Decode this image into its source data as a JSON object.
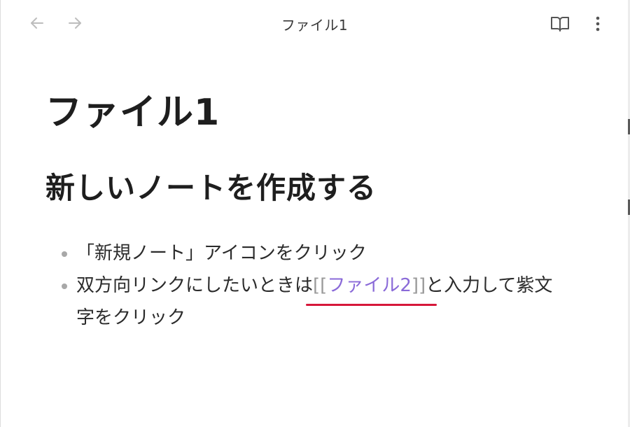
{
  "titlebar": {
    "title": "ファイル1",
    "back_icon": "arrow-left-icon",
    "forward_icon": "arrow-right-icon",
    "reading_icon": "book-open-icon",
    "more_icon": "more-vertical-icon"
  },
  "note": {
    "title": "ファイル1",
    "heading": "新しいノートを作成する",
    "bullets": {
      "item1": "「新規ノート」アイコンをクリック",
      "item2_before": "双方向リンクにしたいときは",
      "item2_bracket_open": "[[",
      "item2_link": "ファイル2",
      "item2_bracket_close": "]]",
      "item2_after": "と入力して紫文字をクリック"
    }
  },
  "colors": {
    "link": "#8a6ad8",
    "annotation_underline": "#d6173a",
    "text": "#1e1e1e"
  }
}
